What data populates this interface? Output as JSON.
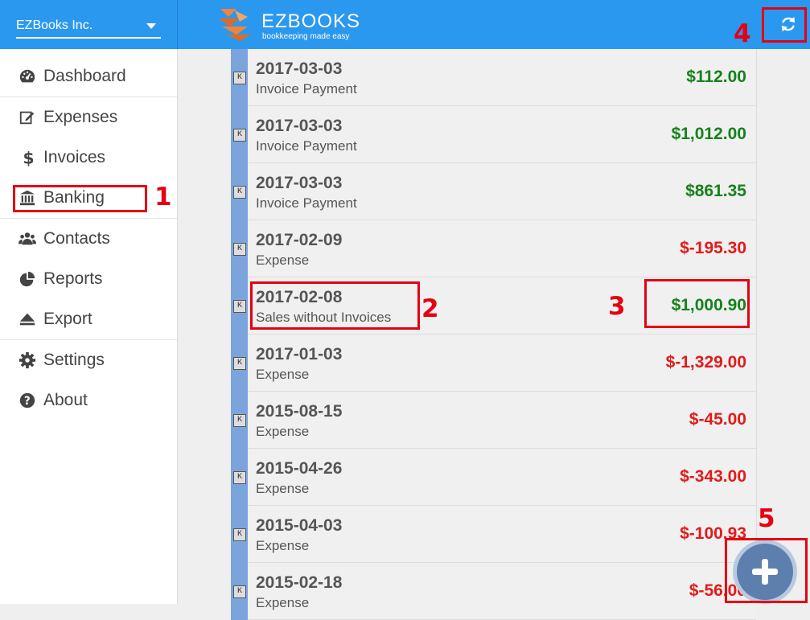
{
  "header": {
    "company": "EZBooks Inc.",
    "logo_title": "EZBOOKS",
    "logo_tagline": "bookkeeping made easy"
  },
  "sidebar": {
    "items": [
      {
        "label": "Dashboard",
        "icon": "dashboard-icon"
      },
      {
        "label": "Expenses",
        "icon": "edit-icon"
      },
      {
        "label": "Invoices",
        "icon": "dollar-icon"
      },
      {
        "label": "Banking",
        "icon": "bank-icon"
      },
      {
        "label": "Contacts",
        "icon": "users-icon"
      },
      {
        "label": "Reports",
        "icon": "pie-chart-icon"
      },
      {
        "label": "Export",
        "icon": "eject-icon"
      },
      {
        "label": "Settings",
        "icon": "gear-icon"
      },
      {
        "label": "About",
        "icon": "question-icon"
      }
    ]
  },
  "transactions": [
    {
      "badge": "K",
      "date": "2017-03-03",
      "type": "Invoice Payment",
      "amount": "$112.00",
      "sign": "pos"
    },
    {
      "badge": "K",
      "date": "2017-03-03",
      "type": "Invoice Payment",
      "amount": "$1,012.00",
      "sign": "pos"
    },
    {
      "badge": "K",
      "date": "2017-03-03",
      "type": "Invoice Payment",
      "amount": "$861.35",
      "sign": "pos"
    },
    {
      "badge": "K",
      "date": "2017-02-09",
      "type": "Expense",
      "amount": "$-195.30",
      "sign": "neg"
    },
    {
      "badge": "K",
      "date": "2017-02-08",
      "type": "Sales without Invoices",
      "amount": "$1,000.90",
      "sign": "pos"
    },
    {
      "badge": "K",
      "date": "2017-01-03",
      "type": "Expense",
      "amount": "$-1,329.00",
      "sign": "neg"
    },
    {
      "badge": "K",
      "date": "2015-08-15",
      "type": "Expense",
      "amount": "$-45.00",
      "sign": "neg"
    },
    {
      "badge": "K",
      "date": "2015-04-26",
      "type": "Expense",
      "amount": "$-343.00",
      "sign": "neg"
    },
    {
      "badge": "K",
      "date": "2015-04-03",
      "type": "Expense",
      "amount": "$-100.93",
      "sign": "neg"
    },
    {
      "badge": "K",
      "date": "2015-02-18",
      "type": "Expense",
      "amount": "$-56.00",
      "sign": "neg"
    }
  ],
  "annotations": {
    "n1": "1",
    "n2": "2",
    "n3": "3",
    "n4": "4",
    "n5": "5"
  },
  "colors": {
    "header": "#2b98f0",
    "positive": "#15821a",
    "negative": "#e41a1a",
    "annotation": "#e60012",
    "row_strip": "#7ca4dc"
  }
}
